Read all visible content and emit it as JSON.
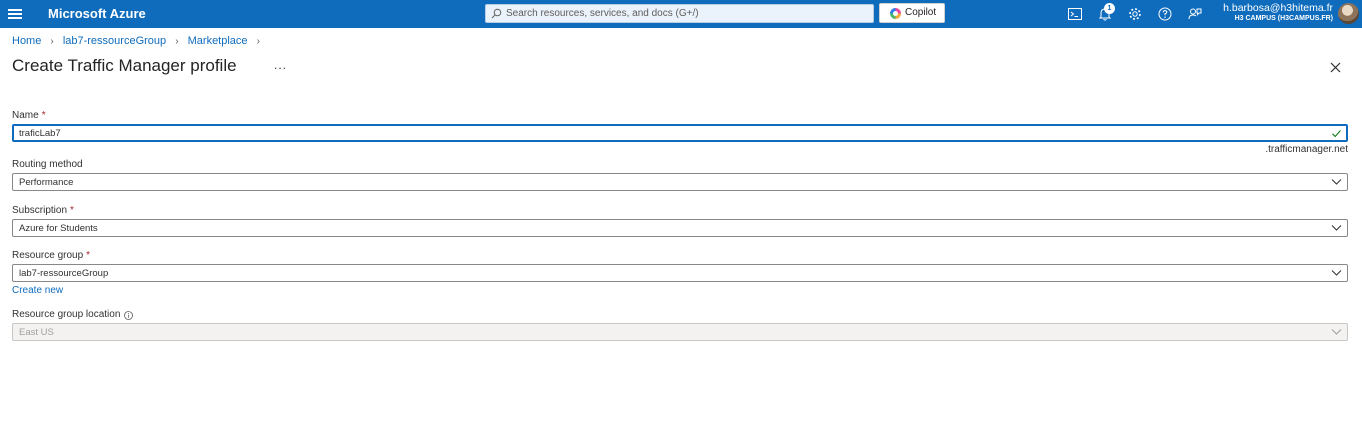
{
  "header": {
    "brand": "Microsoft Azure",
    "search_placeholder": "Search resources, services, and docs (G+/)",
    "copilot_label": "Copilot",
    "notification_count": "1",
    "user_email": "h.barbosa@h3hitema.fr",
    "user_tenant": "H3 CAMPUS (H3CAMPUS.FR)",
    "accent_color": "#0f6cbd",
    "icons": [
      "menu-icon",
      "cloud-shell-icon",
      "notifications-icon",
      "settings-icon",
      "help-icon",
      "feedback-icon"
    ]
  },
  "breadcrumb": {
    "items": [
      "Home",
      "lab7-ressourceGroup",
      "Marketplace"
    ]
  },
  "page": {
    "title": "Create Traffic Manager profile",
    "more_label": "..."
  },
  "form": {
    "name": {
      "label": "Name",
      "required": "*",
      "value": "traficLab7",
      "suffix": ".trafficmanager.net"
    },
    "routing_method": {
      "label": "Routing method",
      "value": "Performance"
    },
    "subscription": {
      "label": "Subscription",
      "required": "*",
      "value": "Azure for Students"
    },
    "resource_group": {
      "label": "Resource group",
      "required": "*",
      "value": "lab7-ressourceGroup",
      "create_new": "Create new"
    },
    "location": {
      "label": "Resource group location",
      "value": "East US"
    }
  }
}
